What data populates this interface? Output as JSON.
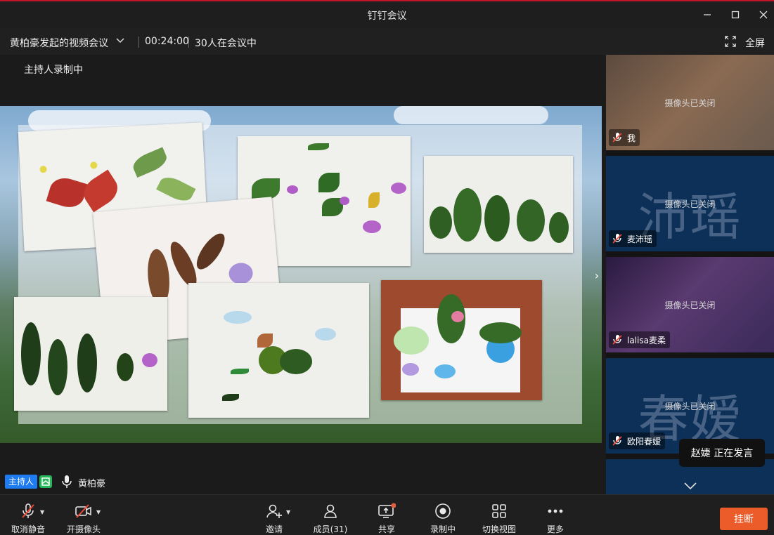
{
  "window": {
    "title": "钉钉会议"
  },
  "info": {
    "meeting_name": "黄柏豪发起的视频会议",
    "duration": "00:24:00",
    "participants_text": "30人在会议中",
    "fullscreen_label": "全屏"
  },
  "stage": {
    "recording_label": "主持人录制中",
    "host_badge": "主持人",
    "host_name": "黄柏豪"
  },
  "sidebar": {
    "tiles": [
      {
        "name": "我",
        "status": "摄像头已关闭",
        "avatar_text": ""
      },
      {
        "name": "麦沛瑶",
        "status": "摄像头已关闭",
        "avatar_text": "沛瑶"
      },
      {
        "name": "lalisa麦柔",
        "status": "摄像头已关闭",
        "avatar_text": ""
      },
      {
        "name": "欧阳春嫒",
        "status": "摄像头已关闭",
        "avatar_text": "春嫒"
      }
    ],
    "speaking_tooltip": "赵婕  正在发言"
  },
  "toolbar": {
    "mute_label": "取消静音",
    "camera_label": "开摄像头",
    "invite_label": "邀请",
    "members_label": "成员(31)",
    "share_label": "共享",
    "record_label": "录制中",
    "layout_label": "切换视图",
    "more_label": "更多",
    "hangup_label": "挂断"
  },
  "colors": {
    "accent_red": "#c0152a",
    "host_blue": "#1e7bf0",
    "hangup_orange": "#ec5b2a",
    "record_dot": "#e55b3c"
  }
}
